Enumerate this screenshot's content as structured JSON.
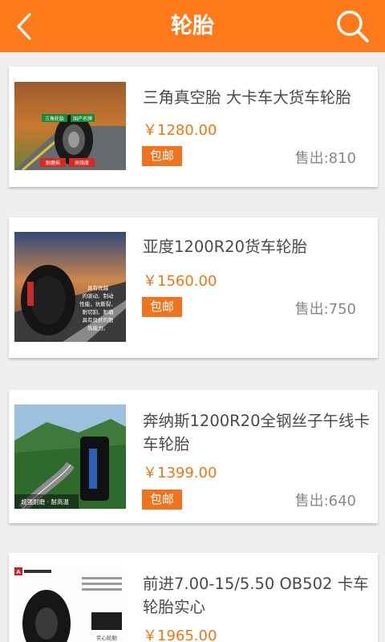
{
  "header": {
    "title": "轮胎",
    "back_icon": "chevron-left-icon",
    "search_icon": "search-icon",
    "color": "#ff7a1a"
  },
  "products": [
    {
      "name": "三角真空胎 大卡车大货车轮胎",
      "price": "￥1280.00",
      "badge": "包邮",
      "sold": "售出:810",
      "image_labels": [
        "三角轮胎",
        "国产名牌",
        "耐磨损",
        "高强度"
      ]
    },
    {
      "name": "亚度1200R20货车轮胎",
      "price": "￥1560.00",
      "badge": "包邮",
      "sold": "售出:750",
      "image_labels": [
        "具有优越",
        "的驱动、制动",
        "性能，抗撕裂、",
        "耐切割、耐磨",
        "具有良好的散",
        "热能力。"
      ]
    },
    {
      "name": "奔纳斯1200R20全钢丝子午线卡车轮胎",
      "price": "￥1399.00",
      "badge": "包邮",
      "sold": "售出:640",
      "image_labels": [
        "超强耐磨 · 耐高温"
      ]
    },
    {
      "name": "前进7.00-15/5.50 OB502 卡车轮胎实心",
      "price": "￥1965.00",
      "badge": "",
      "sold": "",
      "image_labels": [
        "A",
        "实心轮胎"
      ]
    }
  ],
  "colors": {
    "accent": "#ff7a1a",
    "price": "#f07614",
    "badge": "#f0741e"
  }
}
